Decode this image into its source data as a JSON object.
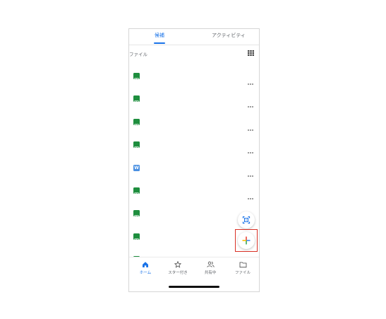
{
  "tabs": [
    {
      "label": "候補",
      "active": true
    },
    {
      "label": "アクティビティ",
      "active": false
    }
  ],
  "section": {
    "title": "ファイル",
    "view_toggle_icon": "grid-view-icon"
  },
  "files": [
    {
      "type": "sheets",
      "icon": "sheets-icon",
      "color": "#1e8e3e"
    },
    {
      "type": "sheets",
      "icon": "sheets-icon",
      "color": "#1e8e3e"
    },
    {
      "type": "sheets",
      "icon": "sheets-icon",
      "color": "#1e8e3e"
    },
    {
      "type": "sheets",
      "icon": "sheets-icon",
      "color": "#1e8e3e"
    },
    {
      "type": "word",
      "icon": "word-icon",
      "color": "#4a90e2",
      "letter": "W"
    },
    {
      "type": "sheets",
      "icon": "sheets-icon",
      "color": "#1e8e3e"
    },
    {
      "type": "sheets",
      "icon": "sheets-icon",
      "color": "#1e8e3e"
    },
    {
      "type": "sheets",
      "icon": "sheets-icon",
      "color": "#1e8e3e"
    },
    {
      "type": "sheets",
      "icon": "sheets-icon",
      "color": "#1e8e3e"
    }
  ],
  "fabs": {
    "scan_icon": "document-scan-icon",
    "new_icon": "plus-icon"
  },
  "nav": [
    {
      "label": "ホーム",
      "icon": "home-icon",
      "active": true
    },
    {
      "label": "スター付き",
      "icon": "star-icon",
      "active": false
    },
    {
      "label": "共有中",
      "icon": "people-icon",
      "active": false
    },
    {
      "label": "ファイル",
      "icon": "folder-icon",
      "active": false
    }
  ],
  "colors": {
    "accent": "#1a73e8",
    "highlight": "#d93025"
  }
}
